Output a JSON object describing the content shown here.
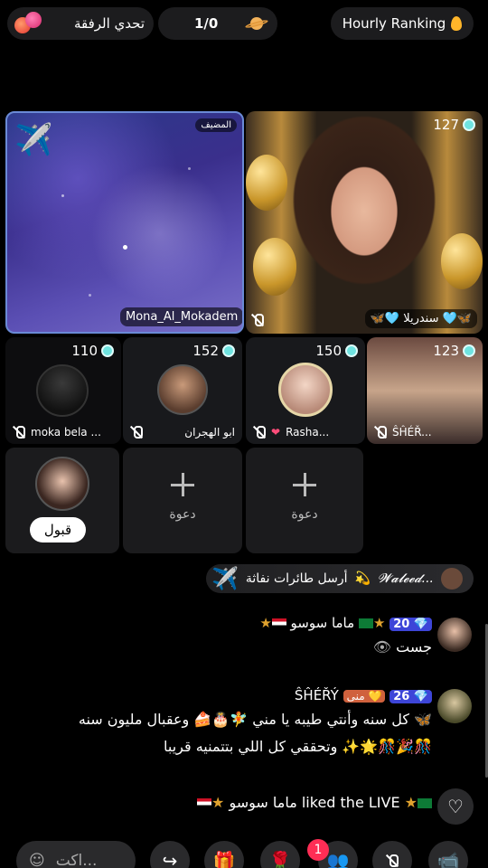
{
  "top_bar": {
    "challenge_label": "تحدي الرفقة",
    "score": "1/0",
    "ranking_label": "Hourly Ranking"
  },
  "host_tile": {
    "badge": "المضيف",
    "name": "Mona_Al_Mokadem"
  },
  "main_guest": {
    "count": "127",
    "name": "🦋🩵 سندريلا 🩵🦋"
  },
  "guests": [
    {
      "count": "110",
      "name": "moka bela ..."
    },
    {
      "count": "152",
      "name": "ابو الهجران"
    },
    {
      "count": "150",
      "name": "Rasha..."
    },
    {
      "count": "123",
      "name": "ŜĤÉŘ..."
    }
  ],
  "slots": {
    "accept_label": "قبول",
    "invite_label": "دعوة"
  },
  "gift_banner": {
    "sender": "𝓦𝓪𝓵𝓮𝓮𝓭...",
    "text": "أرسل طائرات نفاثة"
  },
  "chat": [
    {
      "level": "20",
      "name": "ماما سوسو",
      "body": "جست"
    },
    {
      "level": "26",
      "chip": "منى",
      "name": "ŜĤÉŘÝ",
      "line1": "كل سنه وأنتي طيبه يا مني 🧚🎂🍰 وعقبال مليون سنه 🦋",
      "line2": "وتحققي كل اللي بتتمنيه قريبا ✨🌟🎊🎉🎊"
    }
  ],
  "like_notice": {
    "name": "ماما سوسو",
    "text": "liked the LIVE"
  },
  "toolbar": {
    "input_placeholder": "اكت...",
    "notification_count": "1"
  },
  "colors": {
    "background": "#000000",
    "level_badge": "#3d45d8",
    "notification_badge": "#ff2d55"
  }
}
